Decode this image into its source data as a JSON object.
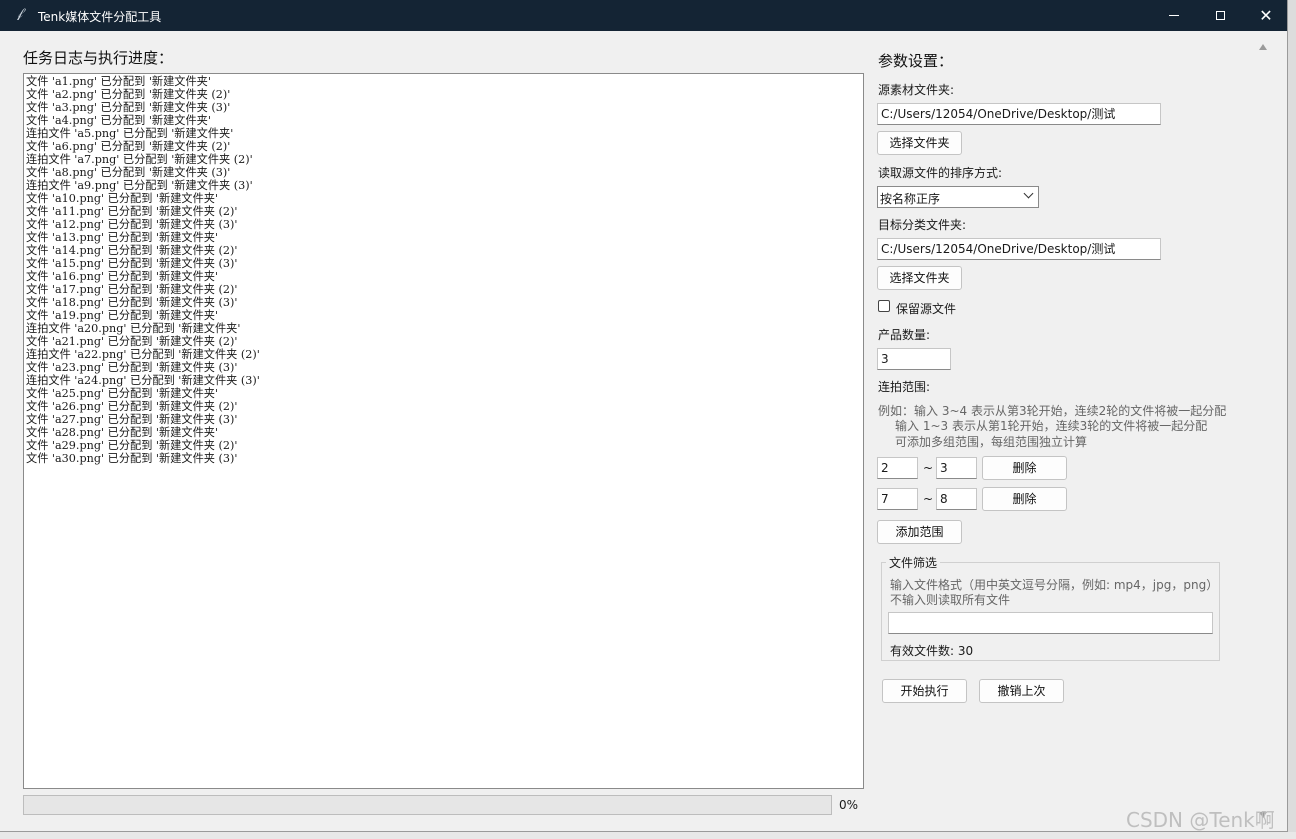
{
  "window": {
    "title": "Tenk媒体文件分配工具",
    "app_icon": "feather-icon",
    "close_glyph": "✕"
  },
  "log": {
    "title": "任务日志与执行进度：",
    "lines": [
      "文件 'a1.png' 已分配到 '新建文件夹'",
      "文件 'a2.png' 已分配到 '新建文件夹 (2)'",
      "文件 'a3.png' 已分配到 '新建文件夹 (3)'",
      "文件 'a4.png' 已分配到 '新建文件夹'",
      "连拍文件 'a5.png' 已分配到 '新建文件夹'",
      "文件 'a6.png' 已分配到 '新建文件夹 (2)'",
      "连拍文件 'a7.png' 已分配到 '新建文件夹 (2)'",
      "文件 'a8.png' 已分配到 '新建文件夹 (3)'",
      "连拍文件 'a9.png' 已分配到 '新建文件夹 (3)'",
      "文件 'a10.png' 已分配到 '新建文件夹'",
      "文件 'a11.png' 已分配到 '新建文件夹 (2)'",
      "文件 'a12.png' 已分配到 '新建文件夹 (3)'",
      "文件 'a13.png' 已分配到 '新建文件夹'",
      "文件 'a14.png' 已分配到 '新建文件夹 (2)'",
      "文件 'a15.png' 已分配到 '新建文件夹 (3)'",
      "文件 'a16.png' 已分配到 '新建文件夹'",
      "文件 'a17.png' 已分配到 '新建文件夹 (2)'",
      "文件 'a18.png' 已分配到 '新建文件夹 (3)'",
      "文件 'a19.png' 已分配到 '新建文件夹'",
      "连拍文件 'a20.png' 已分配到 '新建文件夹'",
      "文件 'a21.png' 已分配到 '新建文件夹 (2)'",
      "连拍文件 'a22.png' 已分配到 '新建文件夹 (2)'",
      "文件 'a23.png' 已分配到 '新建文件夹 (3)'",
      "连拍文件 'a24.png' 已分配到 '新建文件夹 (3)'",
      "文件 'a25.png' 已分配到 '新建文件夹'",
      "文件 'a26.png' 已分配到 '新建文件夹 (2)'",
      "文件 'a27.png' 已分配到 '新建文件夹 (3)'",
      "文件 'a28.png' 已分配到 '新建文件夹'",
      "文件 'a29.png' 已分配到 '新建文件夹 (2)'",
      "文件 'a30.png' 已分配到 '新建文件夹 (3)'"
    ],
    "progress_percent": 0,
    "progress_label": "0%"
  },
  "settings": {
    "title": "参数设置：",
    "source_label": "源素材文件夹:",
    "source_path": "C:/Users/12054/OneDrive/Desktop/测试",
    "choose_folder": "选择文件夹",
    "sort_label": "读取源文件的排序方式:",
    "sort_value": "按名称正序",
    "target_label": "目标分类文件夹:",
    "target_path": "C:/Users/12054/OneDrive/Desktop/测试",
    "keep_source_label": "保留源文件",
    "keep_source_checked": false,
    "count_label": "产品数量:",
    "count_value": "3",
    "burst_label": "连拍范围:",
    "burst_help": [
      "例如：输入 3~4 表示从第3轮开始，连续2轮的文件将被一起分配",
      "输入 1~3 表示从第1轮开始，连续3轮的文件将被一起分配",
      "可添加多组范围，每组范围独立计算"
    ],
    "range_separator": "~",
    "ranges": [
      {
        "start": "2",
        "end": "3",
        "delete": "删除"
      },
      {
        "start": "7",
        "end": "8",
        "delete": "删除"
      }
    ],
    "add_range": "添加范围",
    "filter": {
      "title": "文件筛选",
      "help1": "输入文件格式（用中英文逗号分隔，例如: mp4，jpg，png）",
      "help2": "不输入则读取所有文件",
      "value": "",
      "valid_count": "有效文件数: 30"
    },
    "start_button": "开始执行",
    "undo_button": "撤销上次"
  },
  "watermark": "CSDN @Tenk啊",
  "colors": {
    "titlebar": "#142434",
    "window_bg": "#f0f0f0",
    "progress_fill": "#06b025"
  }
}
